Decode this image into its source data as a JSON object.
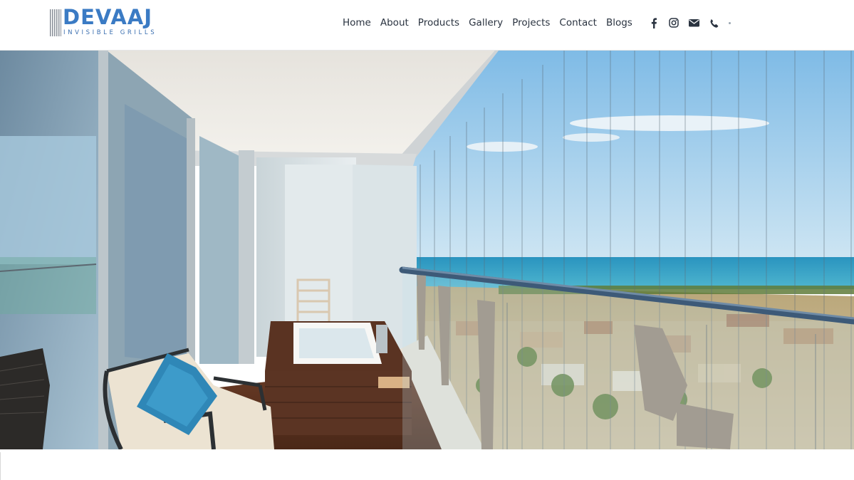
{
  "brand": {
    "name": "DEVAAJ",
    "tagline": "INVISIBLE GRILLS",
    "logo_icon": "grille-bars-icon",
    "color": "#3b7bc4"
  },
  "nav": {
    "items": [
      {
        "label": "Home"
      },
      {
        "label": "About"
      },
      {
        "label": "Products"
      },
      {
        "label": "Gallery"
      },
      {
        "label": "Projects"
      },
      {
        "label": "Contact"
      },
      {
        "label": "Blogs"
      }
    ],
    "text_color": "#2a3340"
  },
  "social": {
    "icons": [
      "facebook-icon",
      "instagram-icon",
      "email-icon",
      "phone-icon"
    ]
  },
  "hero": {
    "image": "balcony-invisible-grills-sea-view",
    "sky_color": "#8cc4ea",
    "sea_color": "#3aa6c8"
  }
}
